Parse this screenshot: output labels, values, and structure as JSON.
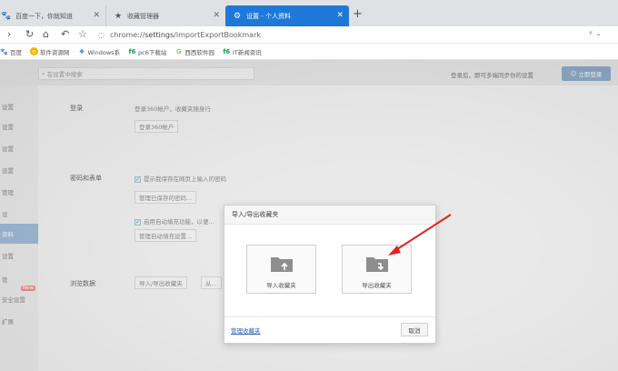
{
  "tabs": [
    {
      "label": "百度一下，你就知道",
      "icon": "paw-icon"
    },
    {
      "label": "收藏管理器",
      "icon": "star-icon"
    },
    {
      "label": "设置 - 个人资料",
      "icon": "gear-icon"
    }
  ],
  "address": {
    "scheme": "chrome://",
    "host": "settings",
    "path": "/importExportBookmark"
  },
  "bookmarks": [
    {
      "label": "百度"
    },
    {
      "label": "软件资源网"
    },
    {
      "label": "Windows系"
    },
    {
      "label": "pc6下载站"
    },
    {
      "label": "西西软件园"
    },
    {
      "label": "IT新闻资讯"
    }
  ],
  "settings": {
    "search_placeholder": "在设置中搜索",
    "sync_text": "登录后，即可多端同步你的设置",
    "login_button": "立即登录",
    "sidebar": [
      "设置",
      "设置",
      "设置",
      "设置",
      "管理",
      "设",
      "资料",
      "设置",
      "管",
      "安全设置",
      "扩展"
    ],
    "new_badge": "New",
    "section_login": "登录",
    "login_desc": "登录360帐户，收藏夹随身行",
    "login_360_button": "登录360帐户",
    "section_password": "密码和表单",
    "save_password_text": "提示我保存在网页上输入的密码",
    "manage_password_button": "管理已保存的密码...",
    "autofill_text": "启用自动填充功能，以便...",
    "manage_autofill_button": "管理自动填充设置...",
    "section_browse": "浏览数据",
    "import_export_button": "导入/导出收藏夹",
    "other_button": "从..."
  },
  "dialog": {
    "title": "导入/导出收藏夹",
    "import_label": "导入收藏夹",
    "export_label": "导出收藏夹",
    "manage_link": "管理收藏夹",
    "cancel": "取消"
  }
}
